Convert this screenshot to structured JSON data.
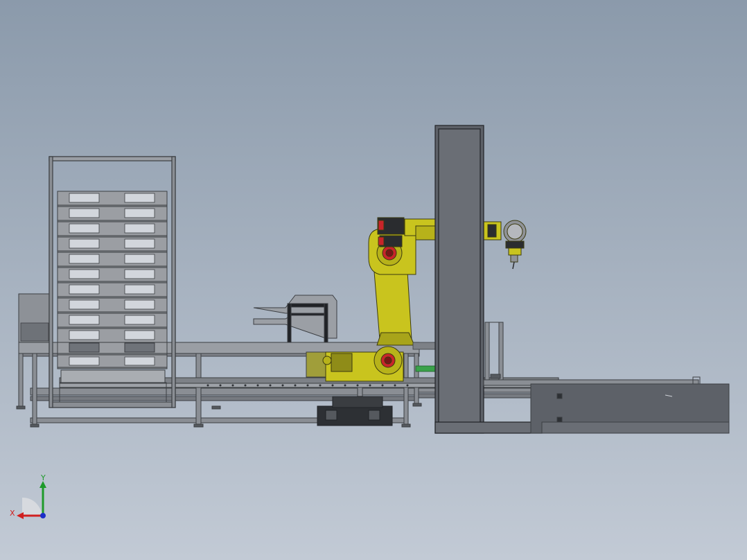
{
  "view": {
    "background_top": "#8b9aab",
    "background_bottom": "#c2cad5"
  },
  "colors": {
    "robot_yellow": "#c9c41e",
    "robot_red": "#c8242a",
    "steel": "#8c9096",
    "column": "#5d6168",
    "conveyor": "#7d8187",
    "accent_green": "#3aa24a"
  },
  "triad": {
    "x_label": "X",
    "y_label": "Y",
    "x_color": "#d02020",
    "y_color": "#1e9a2a",
    "z_color": "#1c2fc8"
  }
}
